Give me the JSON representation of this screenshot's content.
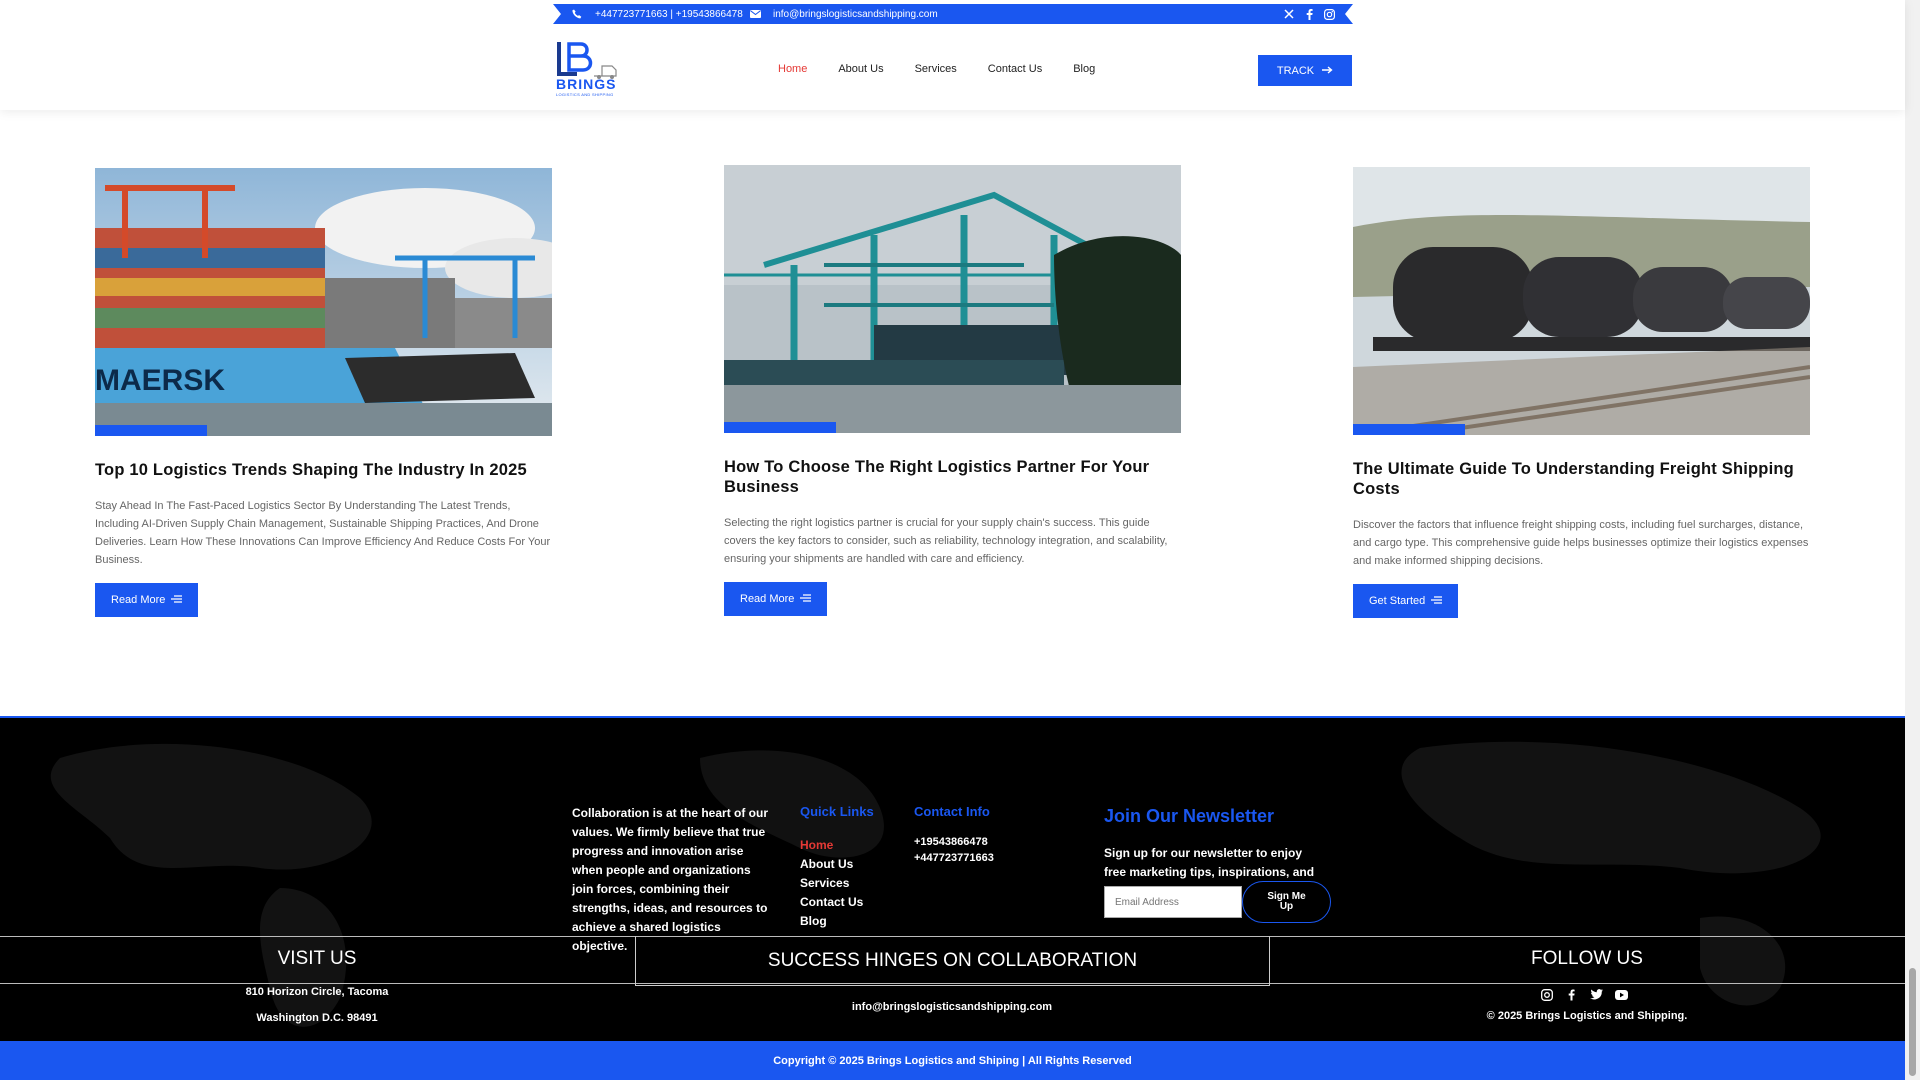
{
  "topbar": {
    "phones": "+447723771663 | +19543866478",
    "email": "info@bringslogisticsandshipping.com",
    "icons": [
      "phone-icon",
      "mail-icon",
      "x-icon",
      "facebook-icon",
      "instagram-icon"
    ]
  },
  "logo": {
    "text": "BRINGS",
    "sub": "LOGISTICS AND SHIPPING"
  },
  "nav": {
    "items": [
      "Home",
      "About Us",
      "Services",
      "Contact Us",
      "Blog"
    ],
    "active": "Home",
    "track_label": "TRACK"
  },
  "cards": [
    {
      "title": "Top 10 Logistics Trends Shaping The Industry In 2025",
      "text": "Stay Ahead In The Fast-Paced Logistics Sector By Understanding The Latest Trends, Including AI-Driven Supply Chain Management, Sustainable Shipping Practices, And Drone Deliveries. Learn How These Innovations Can Improve Efficiency And Reduce Costs For Your Business.",
      "button": "Read More",
      "image_label": "MAERSK"
    },
    {
      "title": "How To Choose The Right Logistics Partner For Your Business",
      "text": "Selecting the right logistics partner is crucial for your supply chain's success. This guide covers the key factors to consider, such as reliability, technology integration, and scalability, ensuring your shipments are handled with care and efficiency.",
      "button": "Read More"
    },
    {
      "title": "The Ultimate Guide To Understanding Freight Shipping Costs",
      "text": "Discover the factors that influence freight shipping costs, including fuel surcharges, distance, and cargo type. This comprehensive guide helps businesses optimize their logistics expenses and make informed shipping decisions.",
      "button": "Get Started"
    }
  ],
  "footer": {
    "about": "Collaboration is at the heart of our values. We firmly believe that true progress and innovation arise when people and organizations join forces, combining their strengths, ideas, and resources to achieve a shared logistics objective.",
    "quick_links_title": "Quick Links",
    "quick_links": [
      "Home",
      "About Us",
      "Services",
      "Contact Us",
      "Blog"
    ],
    "contact_title": "Contact Info",
    "contact_phones": [
      "+19543866478",
      "+447723771663"
    ],
    "newsletter_title": "Join Our Newsletter",
    "newsletter_text": "Sign up for our newsletter to enjoy free marketing tips, inspirations, and more.",
    "email_placeholder": "Email Address",
    "signup_label": "Sign Me Up",
    "visit_title": "VISIT US",
    "visit_line1": "810 Horizon Circle, Tacoma",
    "visit_line2": "Washington D.C. 98491",
    "mid_title": "SUCCESS HINGES ON COLLABORATION",
    "mid_email": "info@bringslogisticsandshipping.com",
    "follow_title": "FOLLOW US",
    "follow_icons": [
      "instagram-icon",
      "facebook-icon",
      "twitter-icon",
      "youtube-icon"
    ],
    "follow_copy": "© 2025 Brings Logistics and Shipping.",
    "copyright": "Copyright © 2025 Brings Logistics and Shiping | All Rights Reserved"
  },
  "colors": {
    "accent": "#1a57f0",
    "active": "#e53935",
    "footer_bg": "#000000"
  }
}
